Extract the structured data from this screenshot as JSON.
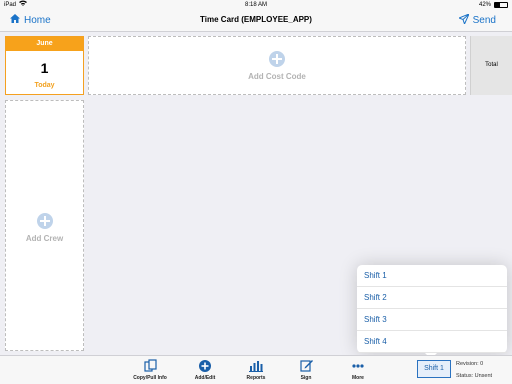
{
  "status_bar": {
    "device": "iPad",
    "time": "8:18 AM",
    "battery": "42%",
    "battery_level": 0.42
  },
  "nav": {
    "back_label": "Home",
    "title": "Time Card (EMPLOYEE_APP)",
    "send_label": "Send"
  },
  "date_card": {
    "month": "June",
    "day": "1",
    "today_label": "Today"
  },
  "cost_code": {
    "add_label": "Add Cost Code"
  },
  "total": {
    "label": "Total"
  },
  "crew": {
    "add_label": "Add Crew"
  },
  "shift_menu": {
    "items": [
      "Shift 1",
      "Shift 2",
      "Shift 3",
      "Shift 4"
    ]
  },
  "toolbar": {
    "copy_label": "Copy/Pull Info",
    "add_edit_label": "Add/Edit",
    "reports_label": "Reports",
    "sign_label": "Sign",
    "more_label": "More",
    "shift_button_label": "Shift 1",
    "revision": "Revision: 0",
    "status": "Status: Unsent"
  },
  "colors": {
    "accent_blue": "#1a73c8",
    "today_orange": "#f7a21b"
  }
}
